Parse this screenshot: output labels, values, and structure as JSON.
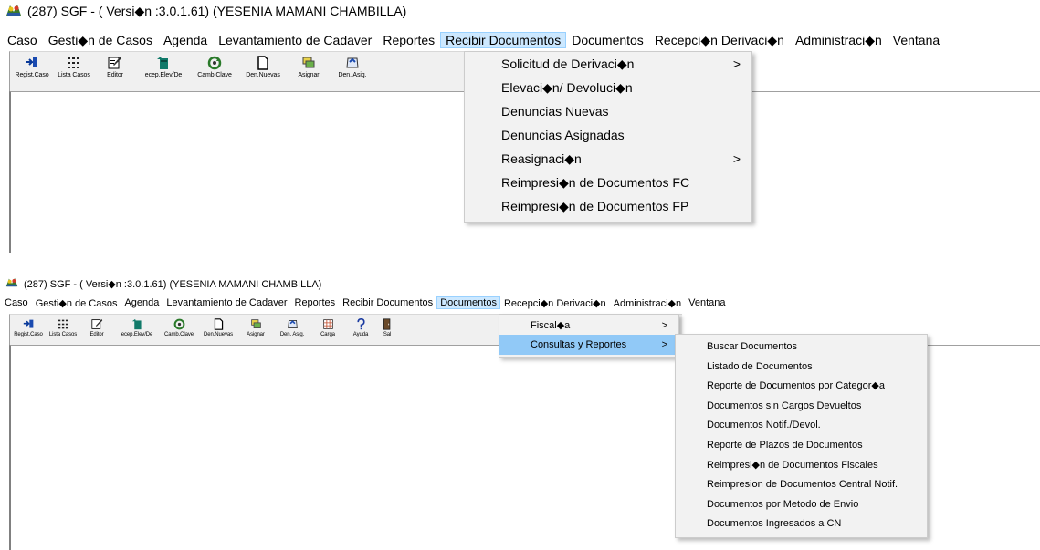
{
  "title": "(287) SGF - ( Versi◆n :3.0.1.61)  (YESENIA MAMANI CHAMBILLA)",
  "menubar": {
    "items": [
      "Caso",
      "Gesti◆n de Casos",
      "Agenda",
      "Levantamiento de Cadaver",
      "Reportes",
      "Recibir Documentos",
      "Documentos",
      "Recepci◆n Derivaci◆n",
      "Administraci◆n",
      "Ventana"
    ]
  },
  "toolbar": {
    "buttons": [
      {
        "label": "Regist.Caso",
        "icon": "register-case-icon"
      },
      {
        "label": "Lista Casos",
        "icon": "list-cases-icon"
      },
      {
        "label": "Editor",
        "icon": "editor-icon"
      },
      {
        "label": "ecep.Elev/De",
        "icon": "trash-elevation-icon"
      },
      {
        "label": "Camb.Clave",
        "icon": "change-password-icon"
      },
      {
        "label": "Den.Nuevas",
        "icon": "new-document-icon"
      },
      {
        "label": "Asignar",
        "icon": "assign-icon"
      },
      {
        "label": "Den. Asig.",
        "icon": "assigned-icon"
      },
      {
        "label": "Carga",
        "icon": "grid-load-icon"
      },
      {
        "label": "Ayuda",
        "icon": "help-icon"
      },
      {
        "label": "Sal",
        "icon": "exit-door-icon"
      }
    ]
  },
  "recibir_menu": {
    "items": [
      {
        "label": "Solicitud de Derivaci◆n",
        "submenu": true
      },
      {
        "label": "Elevaci◆n/ Devoluci◆n",
        "submenu": false
      },
      {
        "label": "Denuncias Nuevas",
        "submenu": false
      },
      {
        "label": "Denuncias Asignadas",
        "submenu": false
      },
      {
        "label": "Reasignaci◆n",
        "submenu": true
      },
      {
        "label": "Reimpresi◆n de Documentos FC",
        "submenu": false
      },
      {
        "label": "Reimpresi◆n de Documentos FP",
        "submenu": false
      }
    ]
  },
  "documentos_menu": {
    "items": [
      {
        "label": "Fiscal◆a",
        "submenu": true
      },
      {
        "label": "Consultas y Reportes",
        "submenu": true
      }
    ]
  },
  "consultas_submenu": {
    "items": [
      "Buscar Documentos",
      "Listado de Documentos",
      "Reporte de Documentos por Categor◆a",
      "Documentos sin Cargos Devueltos",
      "Documentos Notif./Devol.",
      "Reporte de Plazos de Documentos",
      "Reimpresi◆n de Documentos Fiscales",
      "Reimpresion de Documentos Central Notif.",
      "Documentos por Metodo de Envio",
      "Documentos Ingresados a CN"
    ]
  },
  "submenu_arrow": ">",
  "colors": {
    "menu_highlight": "#cce8ff",
    "item_highlight": "#91c9f7",
    "menu_bg": "#f2f2f2",
    "toolbar_bg": "#f0f0f0"
  }
}
